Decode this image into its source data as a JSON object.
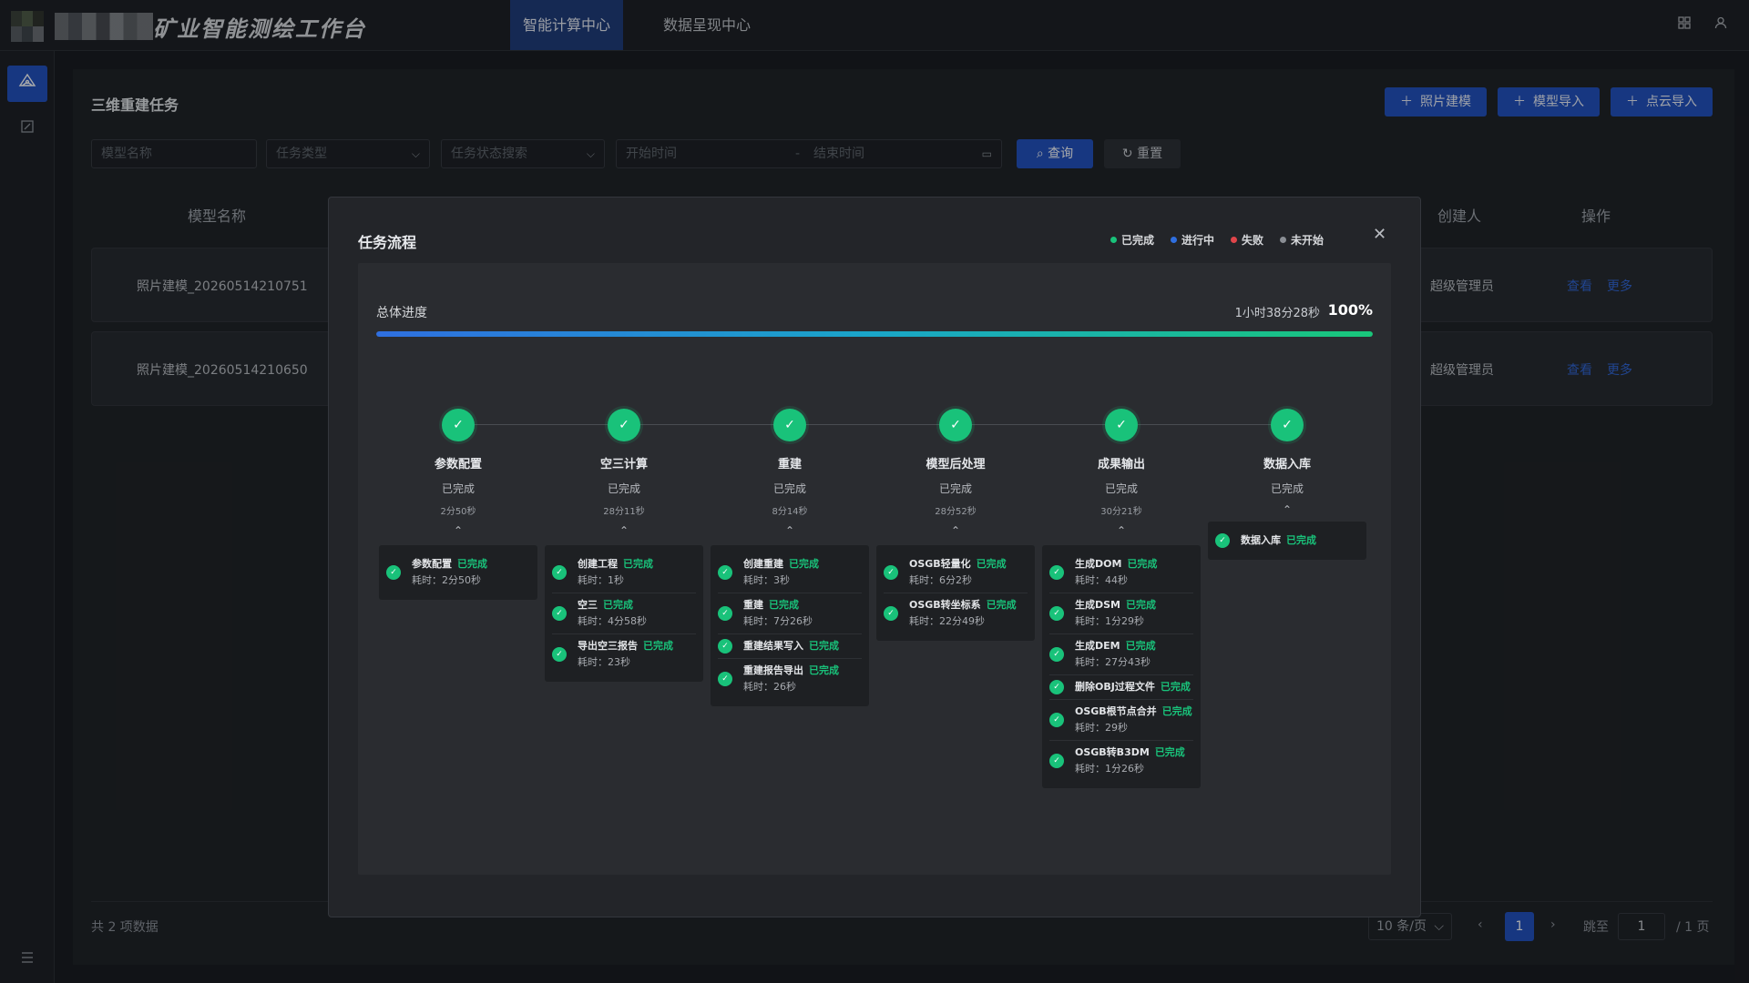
{
  "header": {
    "app_title": "矿业智能测绘工作台",
    "nav": [
      "智能计算中心",
      "数据呈现中心"
    ],
    "icons": [
      "grid-icon",
      "user-icon"
    ]
  },
  "sidebar": {
    "icons": [
      "reconstruction-icon",
      "edit-icon",
      "menu-icon"
    ]
  },
  "page": {
    "title": "三维重建任务",
    "actions": [
      "照片建模",
      "模型导入",
      "点云导入"
    ],
    "filters": {
      "model_name_placeholder": "模型名称",
      "task_type_placeholder": "任务类型",
      "task_status_placeholder": "任务状态搜索",
      "start_placeholder": "开始时间",
      "range_sep": "-",
      "end_placeholder": "结束时间",
      "query": "查询",
      "reset": "重置"
    },
    "columns": [
      "模型名称",
      "创建人",
      "操作"
    ],
    "rows": [
      {
        "name": "照片建模_20260514210751",
        "creator": "超级管理员",
        "view": "查看",
        "more": "更多"
      },
      {
        "name": "照片建模_20260514210650",
        "creator": "超级管理员",
        "view": "查看",
        "more": "更多"
      }
    ],
    "footer": {
      "total": "共 2 项数据",
      "page_size": "10 条/页",
      "current_page": "1",
      "jump_label": "跳至",
      "jump_value": "1",
      "page_count": "/ 1 页"
    }
  },
  "modal": {
    "title": "任务流程",
    "legend": [
      {
        "label": "已完成",
        "color": "#19c27a"
      },
      {
        "label": "进行中",
        "color": "#2f6fe0"
      },
      {
        "label": "失败",
        "color": "#e0454a"
      },
      {
        "label": "未开始",
        "color": "#8a8e94"
      }
    ],
    "progress": {
      "label": "总体进度",
      "elapsed": "1小时38分28秒",
      "percent_text": "100%",
      "percent": 100
    },
    "stages": [
      {
        "name": "参数配置",
        "status": "已完成",
        "duration": "2分50秒",
        "steps": [
          {
            "name": "参数配置",
            "status": "已完成",
            "time": "耗时：2分50秒"
          }
        ]
      },
      {
        "name": "空三计算",
        "status": "已完成",
        "duration": "28分11秒",
        "steps": [
          {
            "name": "创建工程",
            "status": "已完成",
            "time": "耗时：1秒"
          },
          {
            "name": "空三",
            "status": "已完成",
            "time": "耗时：4分58秒"
          },
          {
            "name": "导出空三报告",
            "status": "已完成",
            "time": "耗时：23秒"
          }
        ]
      },
      {
        "name": "重建",
        "status": "已完成",
        "duration": "8分14秒",
        "steps": [
          {
            "name": "创建重建",
            "status": "已完成",
            "time": "耗时：3秒"
          },
          {
            "name": "重建",
            "status": "已完成",
            "time": "耗时：7分26秒"
          },
          {
            "name": "重建结果写入",
            "status": "已完成",
            "time": ""
          },
          {
            "name": "重建报告导出",
            "status": "已完成",
            "time": "耗时：26秒"
          }
        ]
      },
      {
        "name": "模型后处理",
        "status": "已完成",
        "duration": "28分52秒",
        "steps": [
          {
            "name": "OSGB轻量化",
            "status": "已完成",
            "time": "耗时：6分2秒"
          },
          {
            "name": "OSGB转坐标系",
            "status": "已完成",
            "time": "耗时：22分49秒"
          }
        ]
      },
      {
        "name": "成果输出",
        "status": "已完成",
        "duration": "30分21秒",
        "steps": [
          {
            "name": "生成DOM",
            "status": "已完成",
            "time": "耗时：44秒"
          },
          {
            "name": "生成DSM",
            "status": "已完成",
            "time": "耗时：1分29秒"
          },
          {
            "name": "生成DEM",
            "status": "已完成",
            "time": "耗时：27分43秒"
          },
          {
            "name": "删除OBJ过程文件",
            "status": "已完成",
            "time": ""
          },
          {
            "name": "OSGB根节点合并",
            "status": "已完成",
            "time": "耗时：29秒"
          },
          {
            "name": "OSGB转B3DM",
            "status": "已完成",
            "time": "耗时：1分26秒"
          }
        ]
      },
      {
        "name": "数据入库",
        "status": "已完成",
        "duration": "",
        "steps": [
          {
            "name": "数据入库",
            "status": "已完成",
            "time": ""
          }
        ]
      }
    ]
  }
}
